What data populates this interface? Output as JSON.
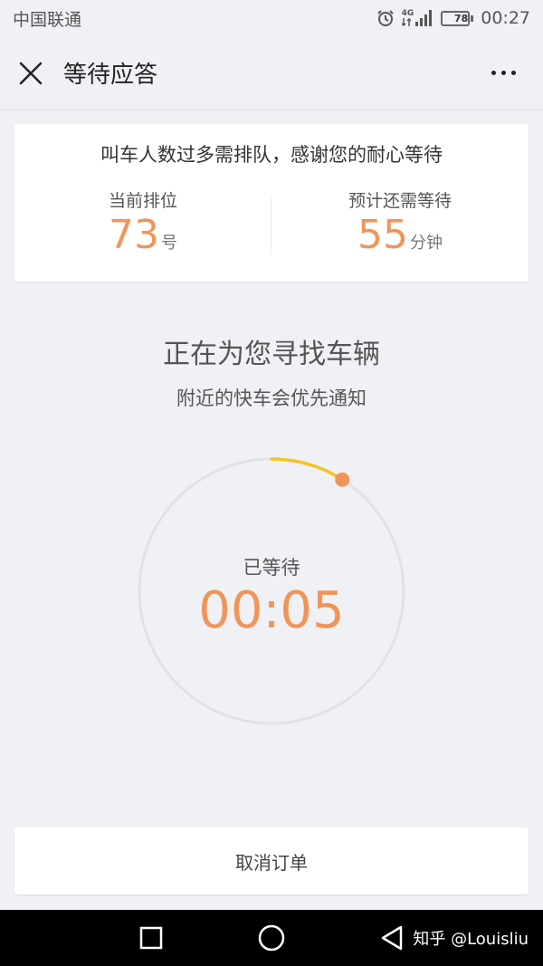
{
  "status_bar": {
    "carrier": "中国联通",
    "network": "4G",
    "battery": "78",
    "battery_level": 0.78,
    "time": "00:27",
    "icons": [
      "alarm-icon",
      "signal-icon",
      "battery-icon"
    ]
  },
  "header": {
    "title": "等待应答",
    "close_icon": "close-icon",
    "more_icon": "more-icon"
  },
  "queue": {
    "message": "叫车人数过多需排队，感谢您的耐心等待",
    "position_label": "当前排位",
    "position_value": "73",
    "position_unit": "号",
    "wait_label": "预计还需等待",
    "wait_value": "55",
    "wait_unit": "分钟"
  },
  "search": {
    "title": "正在为您寻找车辆",
    "subtitle": "附近的快车会优先通知"
  },
  "timer": {
    "label": "已等待",
    "value": "00:05",
    "progress_fraction": 0.09
  },
  "actions": {
    "cancel_label": "取消订单"
  },
  "nav_bar": {
    "icons": [
      "recent-apps-icon",
      "home-icon",
      "back-icon"
    ]
  },
  "watermark": "知乎 @Louisliu",
  "colors": {
    "accent": "#f0955a",
    "arc": "#f5c425",
    "background": "#eff1f4",
    "card": "#ffffff"
  }
}
